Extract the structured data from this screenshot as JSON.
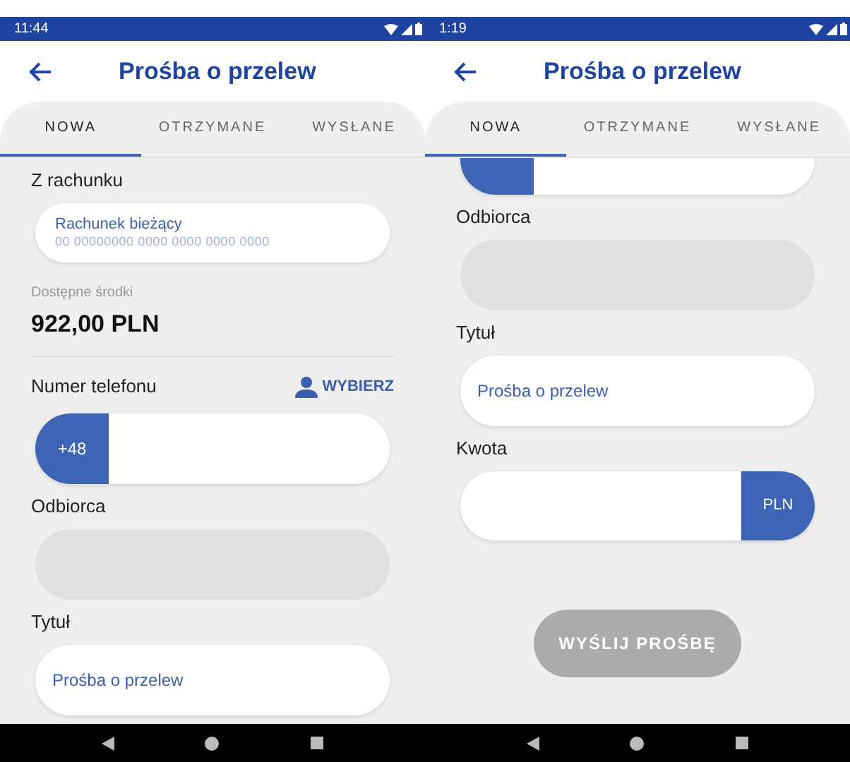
{
  "screens": [
    {
      "status_bar": {
        "time": "11:44"
      },
      "header": {
        "title": "Prośba o przelew"
      },
      "scrolled": false,
      "tabs": [
        {
          "label": "NOWA",
          "selected": true
        },
        {
          "label": "OTRZYMANE",
          "selected": false
        },
        {
          "label": "WYSŁANE",
          "selected": false
        }
      ],
      "items": [
        {
          "kind": "label",
          "text": "Z rachunku"
        },
        {
          "kind": "account",
          "name": "Rachunek bieżący",
          "number": "00 00000000 0000 0000 0000 0000"
        },
        {
          "kind": "balance",
          "caption": "Dostępne środki",
          "amount": "922,00 PLN"
        },
        {
          "kind": "section_header",
          "text": "Numer telefonu",
          "action": "WYBIERZ"
        },
        {
          "kind": "phone",
          "prefix": "+48"
        },
        {
          "kind": "label",
          "text": "Odbiorca"
        },
        {
          "kind": "input",
          "disabled": true
        },
        {
          "kind": "label",
          "text": "Tytuł"
        },
        {
          "kind": "input",
          "value": "Prośba o przelew",
          "disabled": false
        }
      ]
    },
    {
      "status_bar": {
        "time": "1:19"
      },
      "header": {
        "title": "Prośba o przelew"
      },
      "scrolled": true,
      "tabs": [
        {
          "label": "NOWA",
          "selected": true
        },
        {
          "label": "OTRZYMANE",
          "selected": false
        },
        {
          "label": "WYSŁANE",
          "selected": false
        }
      ],
      "items": [
        {
          "kind": "phone"
        },
        {
          "kind": "label",
          "text": "Odbiorca"
        },
        {
          "kind": "input",
          "disabled": true
        },
        {
          "kind": "label",
          "text": "Tytuł"
        },
        {
          "kind": "input",
          "value": "Prośba o przelew",
          "disabled": false
        },
        {
          "kind": "label",
          "text": "Kwota"
        },
        {
          "kind": "amount",
          "currency": "PLN"
        },
        {
          "kind": "button",
          "text": "WYŚLIJ PROŚBĘ",
          "disabled": true
        }
      ]
    }
  ]
}
